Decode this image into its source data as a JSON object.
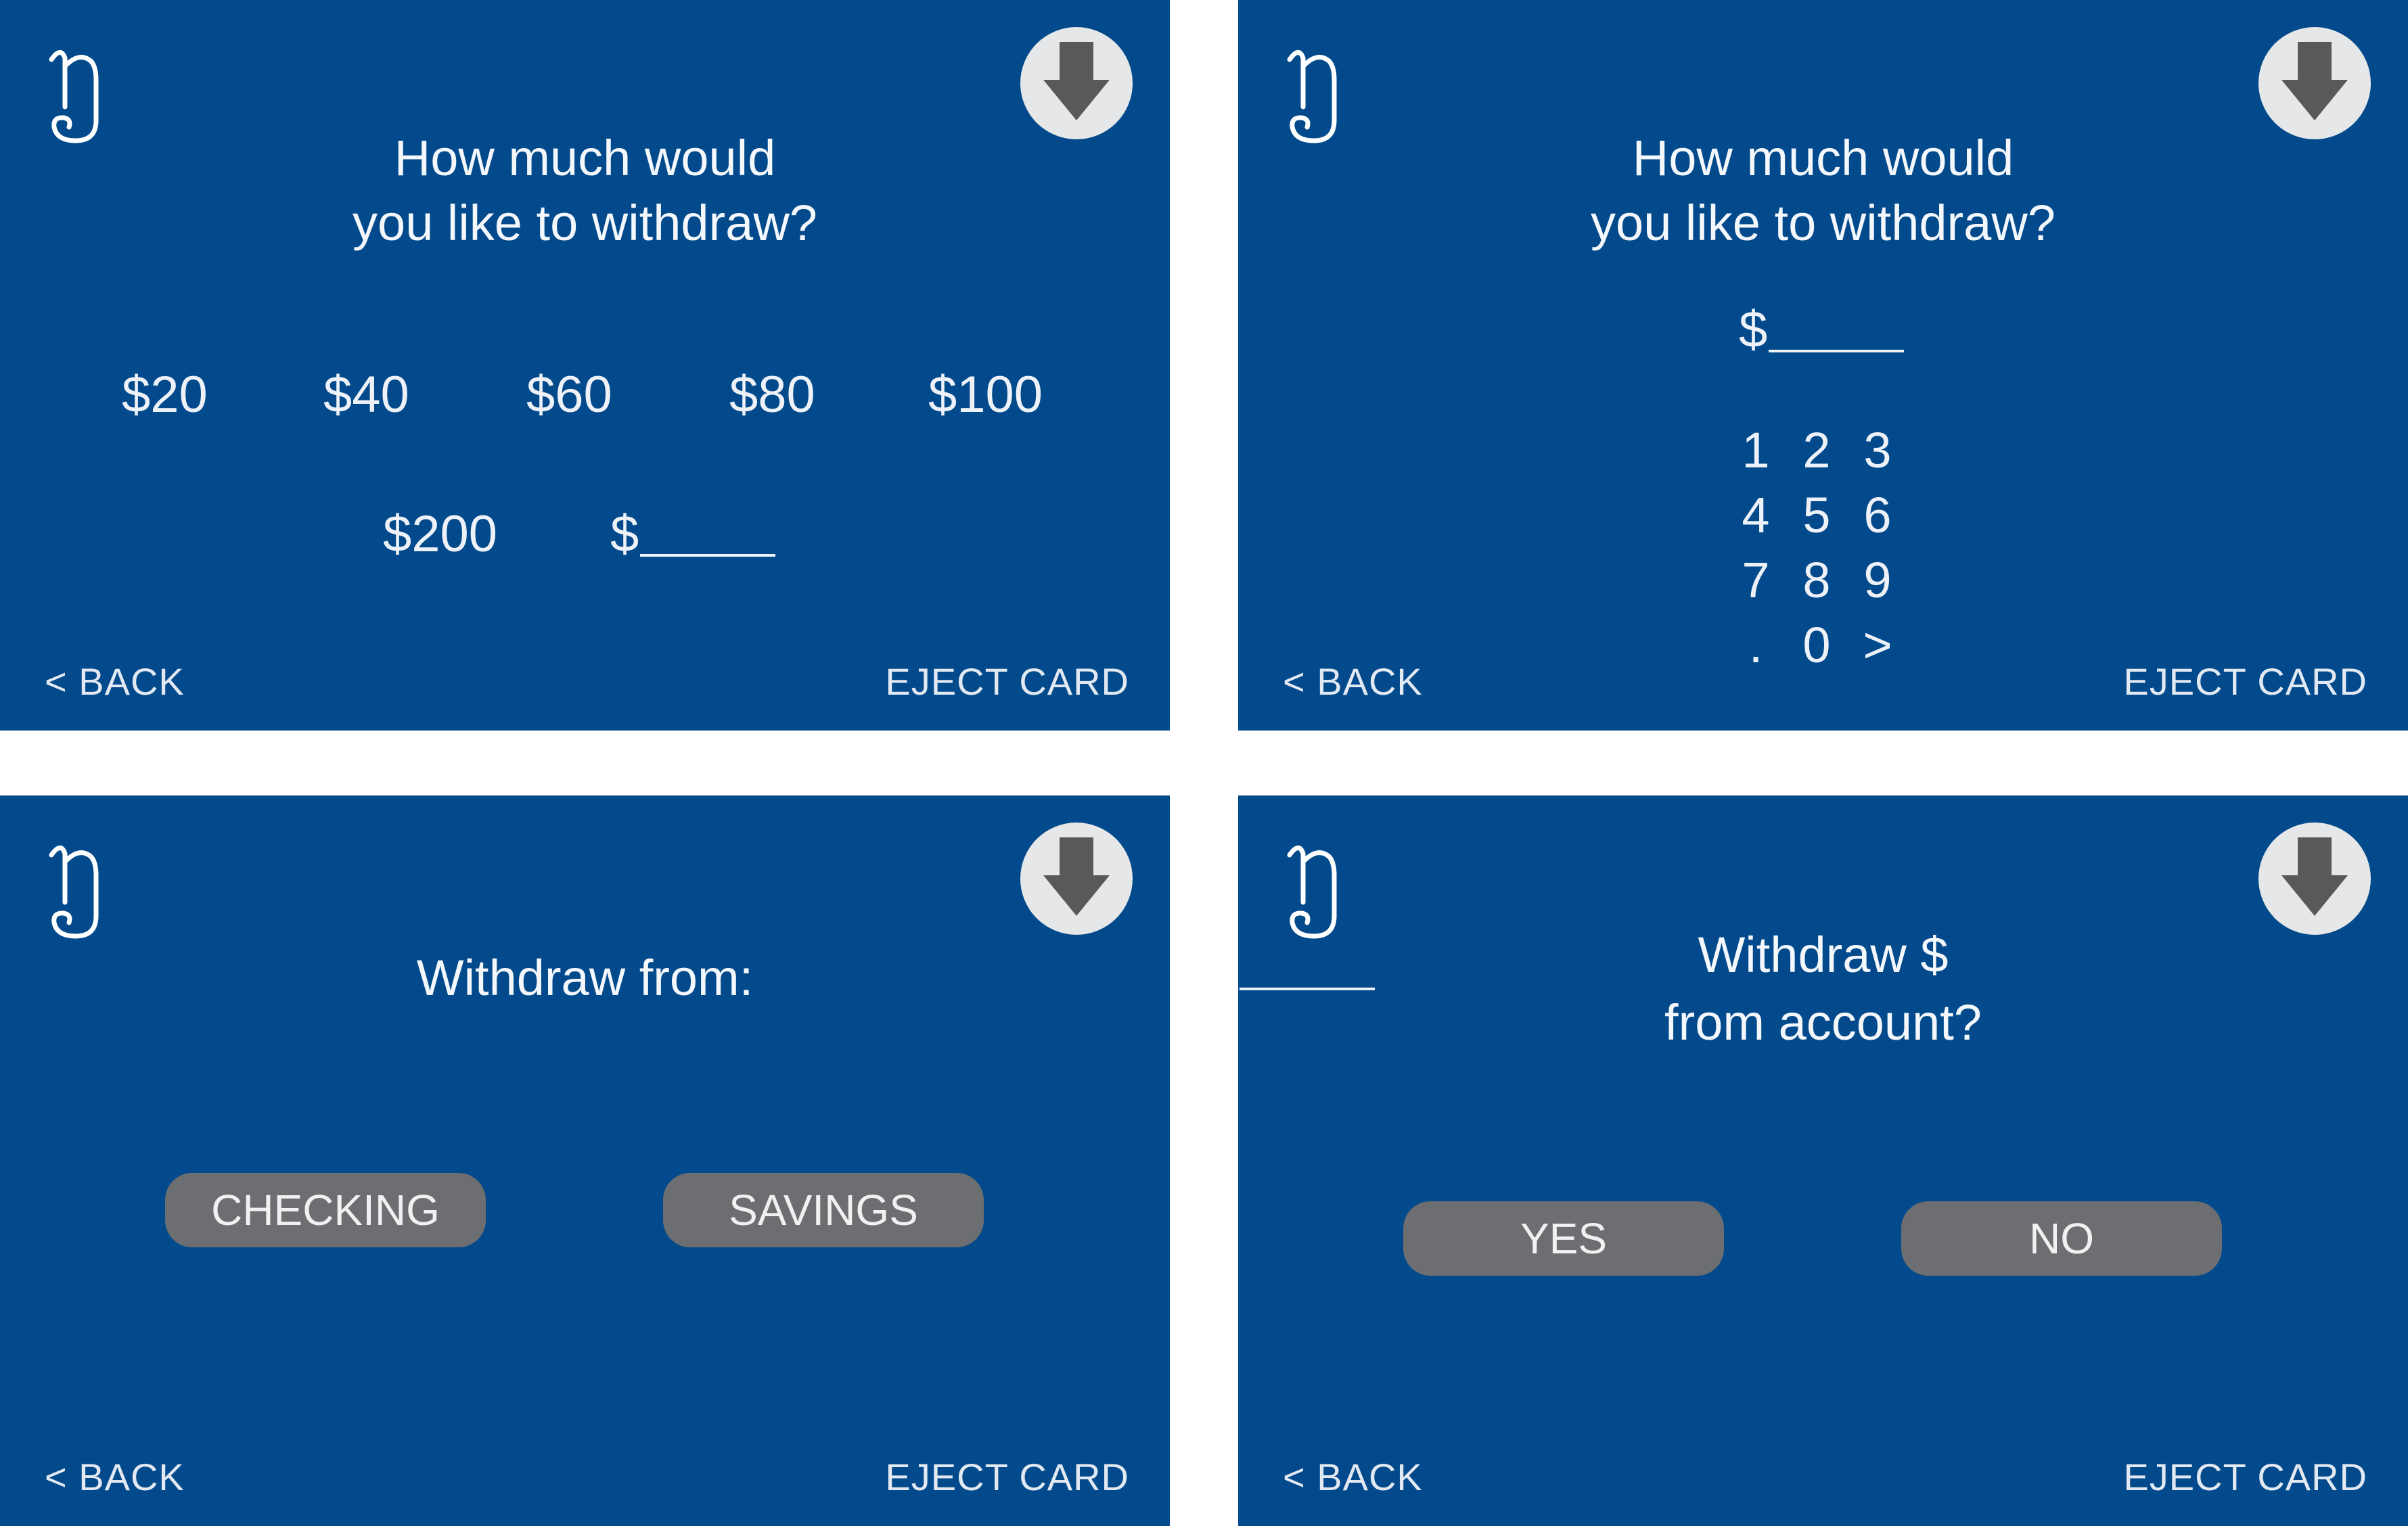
{
  "common": {
    "back_label": "< BACK",
    "eject_label": "EJECT CARD"
  },
  "screen_amount_select": {
    "prompt_line1": "How much would",
    "prompt_line2": "you like to withdraw?",
    "amounts": [
      "$20",
      "$40",
      "$60",
      "$80",
      "$100",
      "$200"
    ],
    "custom_prefix": "$"
  },
  "screen_amount_keypad": {
    "prompt_line1": "How much would",
    "prompt_line2": "you like to withdraw?",
    "entry_prefix": "$",
    "keys": [
      "1",
      "2",
      "3",
      "4",
      "5",
      "6",
      "7",
      "8",
      "9",
      ".",
      "0",
      ">"
    ]
  },
  "screen_account_select": {
    "prompt": "Withdraw from:",
    "checking_label": "CHECKING",
    "savings_label": "SAVINGS"
  },
  "screen_confirm": {
    "prompt_line1_prefix": "Withdraw $",
    "prompt_line2": "from account?",
    "yes_label": "YES",
    "no_label": "NO"
  },
  "icons": {
    "logo": "bank-logo-icon",
    "eject": "card-eject-arrow-icon"
  },
  "colors": {
    "screen_background": "#024a8b",
    "button_fill": "#6d6e71",
    "icon_circle": "#e6e7e8",
    "icon_arrow": "#58595b"
  }
}
